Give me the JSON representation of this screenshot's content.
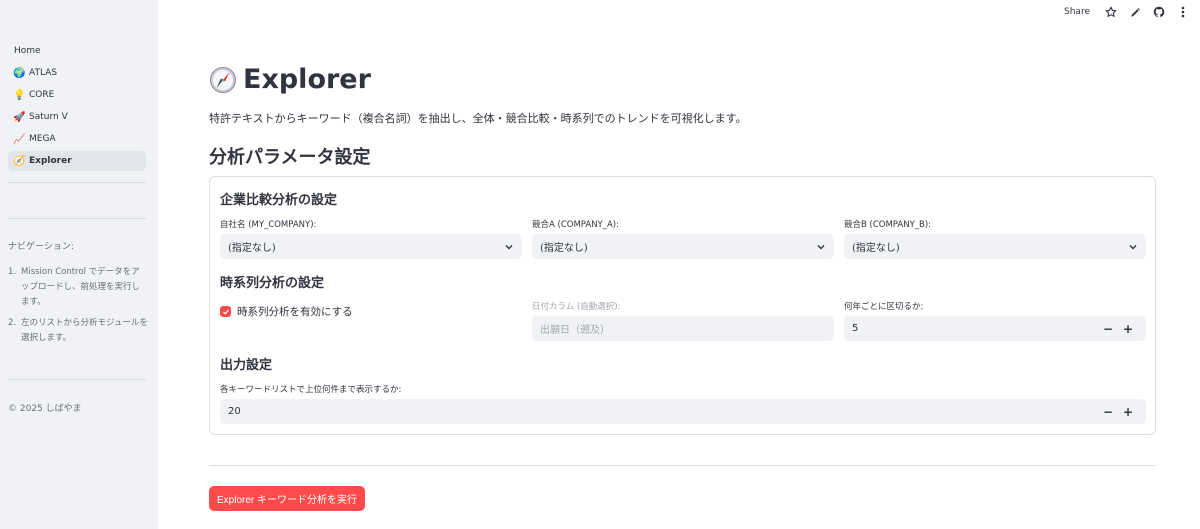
{
  "topbar": {
    "share_label": "Share",
    "icons": [
      "star-icon",
      "pencil-icon",
      "github-icon",
      "more-vertical-icon"
    ]
  },
  "sidebar": {
    "home_label": "Home",
    "items": [
      {
        "label": "ATLAS",
        "icon": "🌍"
      },
      {
        "label": "CORE",
        "icon": "💡"
      },
      {
        "label": "Saturn V",
        "icon": "🚀"
      },
      {
        "label": "MEGA",
        "icon": "📈"
      },
      {
        "label": "Explorer",
        "icon": "🧭"
      }
    ],
    "active_item": "Explorer",
    "nav_heading": "ナビゲーション:",
    "nav_steps": [
      {
        "num": "1.",
        "text": "Mission Control でデータをアップロードし、前処理を実行します。"
      },
      {
        "num": "2.",
        "text": "左のリストから分析モジュールを選択します。"
      }
    ],
    "copyright": "© 2025 しばやま"
  },
  "main": {
    "title": "Explorer",
    "subtitle": "特許テキストからキーワード（複合名詞）を抽出し、全体・競合比較・時系列でのトレンドを可視化します。",
    "params_title": "分析パラメータ設定",
    "company": {
      "heading": "企業比較分析の設定",
      "my_company": {
        "label": "自社名 (MY_COMPANY):",
        "value": "(指定なし)"
      },
      "company_a": {
        "label": "競合A (COMPANY_A):",
        "value": "(指定なし)"
      },
      "company_b": {
        "label": "競合B (COMPANY_B):",
        "value": "(指定なし)"
      }
    },
    "timeseries": {
      "heading": "時系列分析の設定",
      "enable_label": "時系列分析を有効にする",
      "enabled": true,
      "date_col_label": "日付カラム (自動選択):",
      "date_col_value": "出願日（遡及）",
      "interval_label": "何年ごとに区切るか:",
      "interval_value": "5"
    },
    "output": {
      "heading": "出力設定",
      "topn_label": "各キーワードリストで上位何件まで表示するか:",
      "topn_value": "20"
    },
    "run_button": "Explorer キーワード分析を実行"
  },
  "colors": {
    "accent": "#ff4b4b",
    "sidebar_bg": "#f0f2f6",
    "input_bg": "#f0f2f6",
    "text": "#31333f"
  }
}
